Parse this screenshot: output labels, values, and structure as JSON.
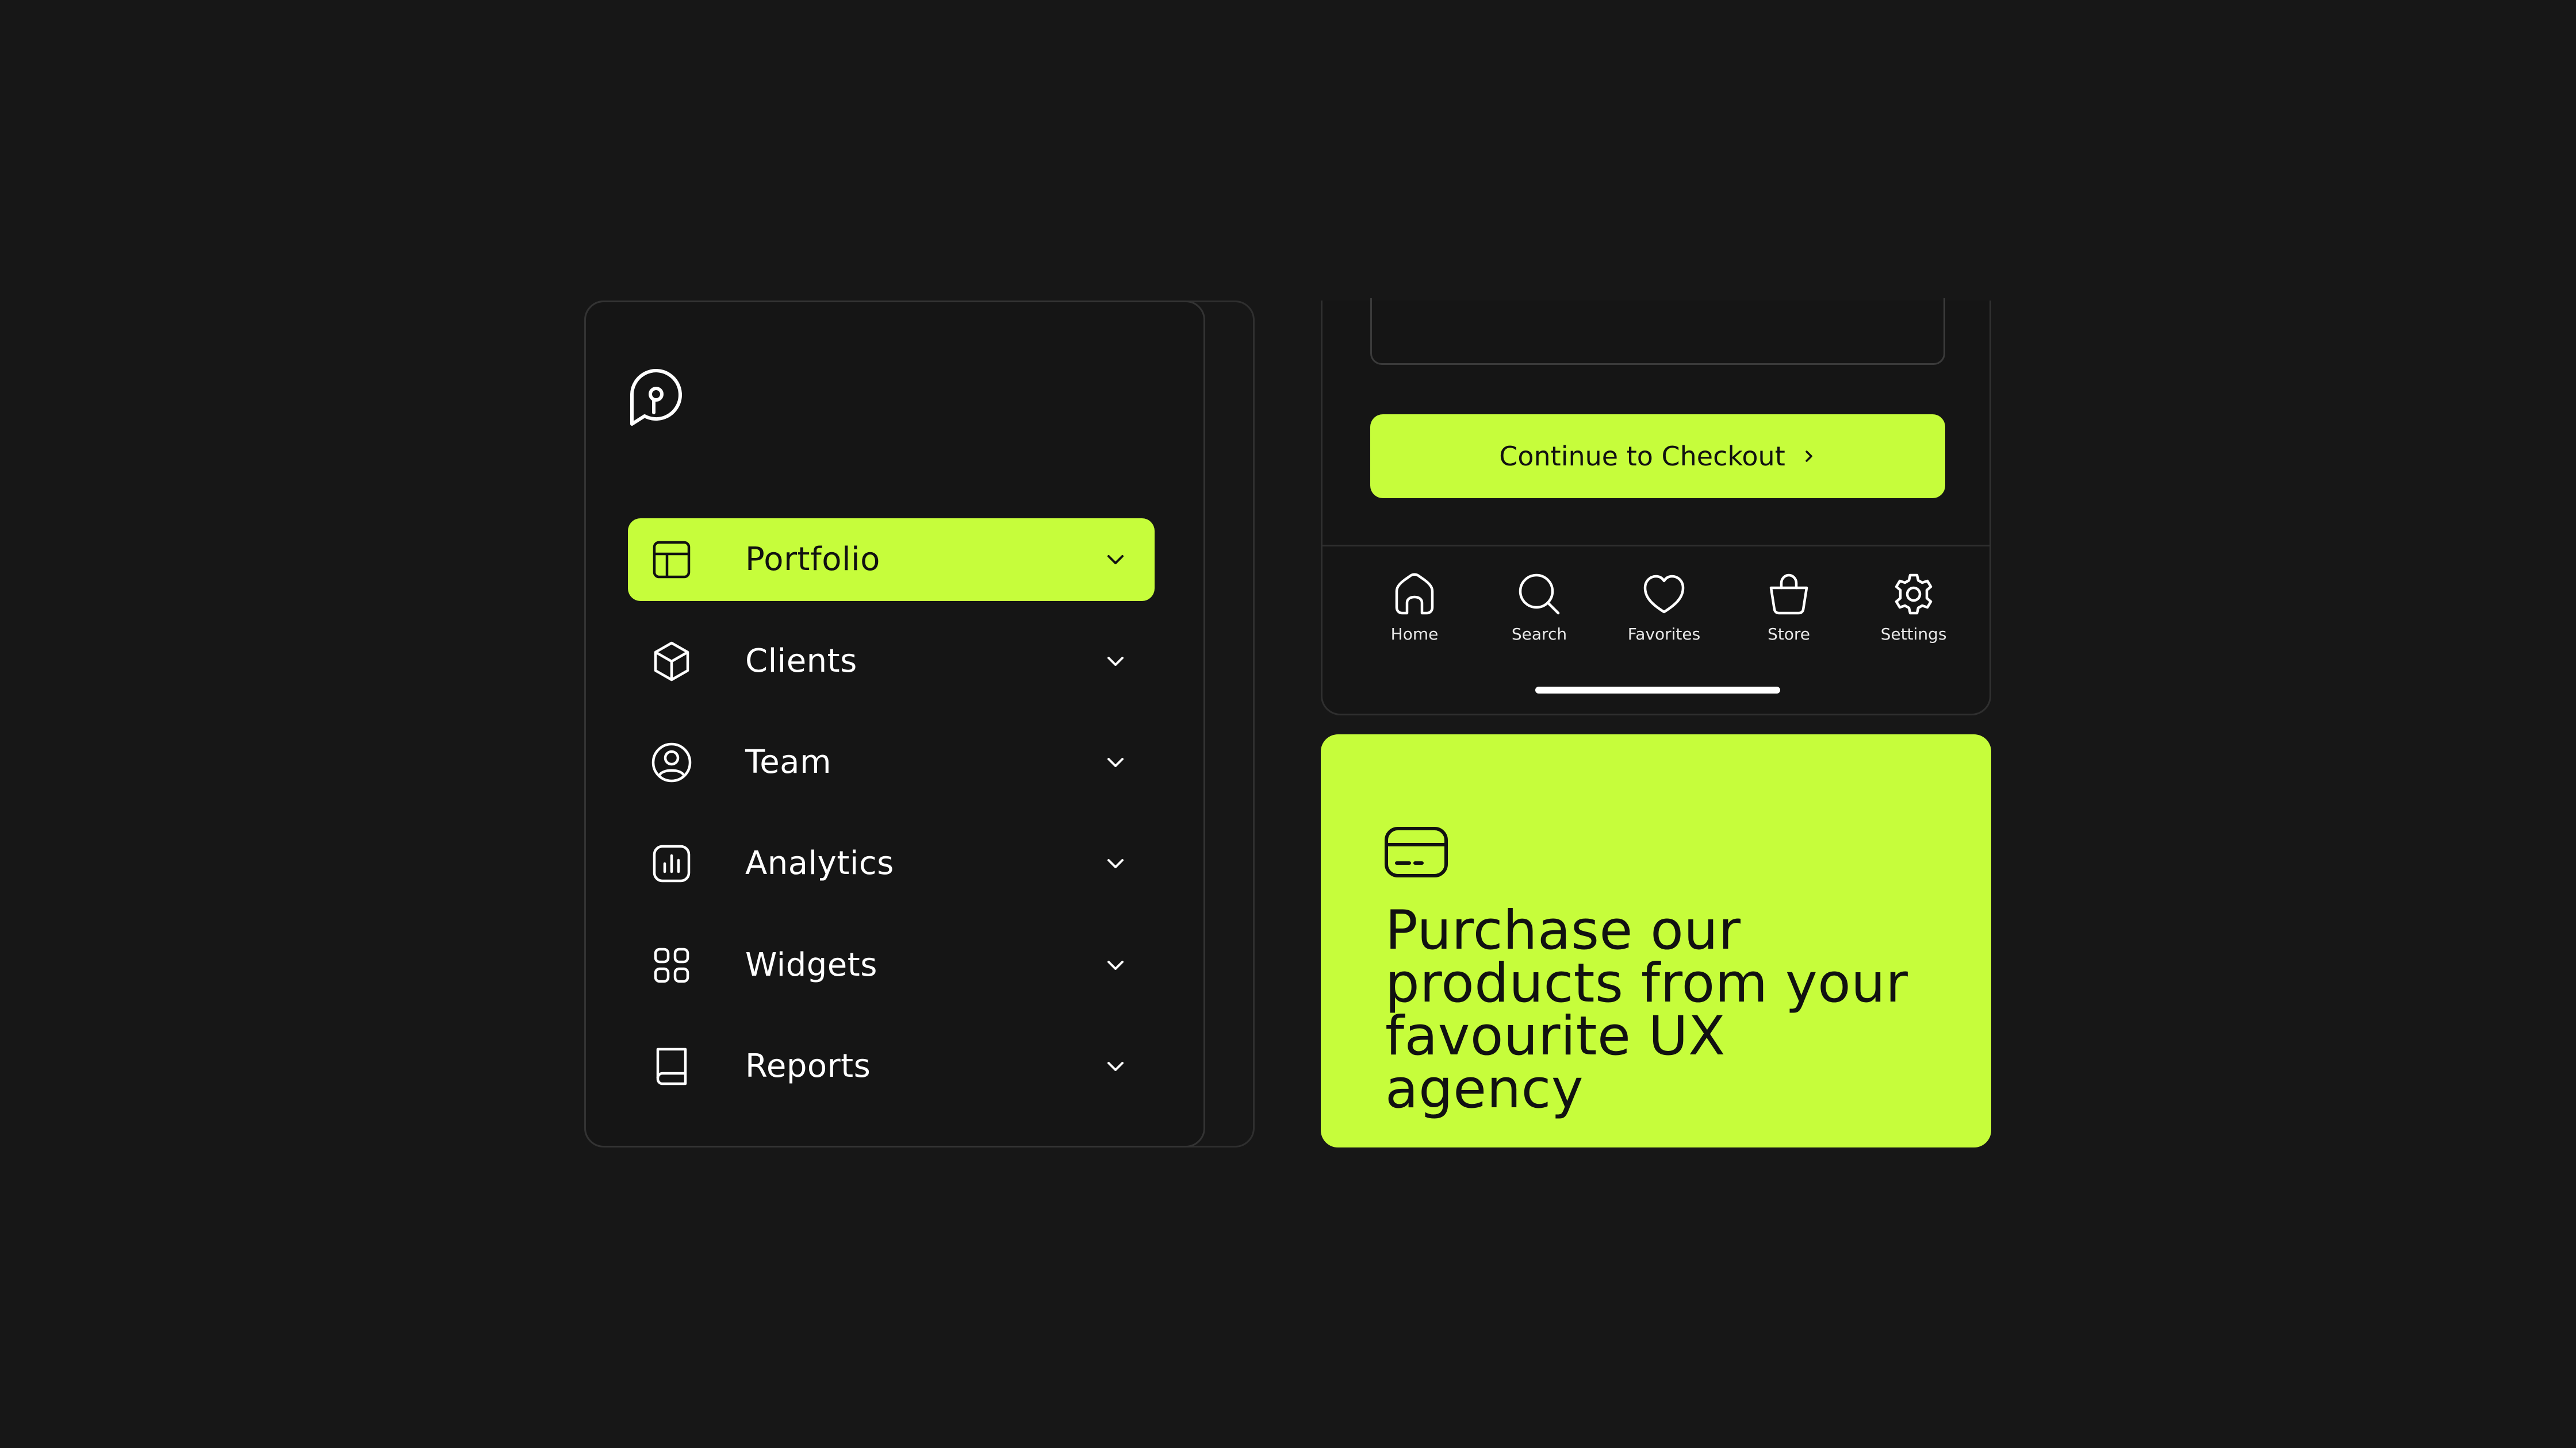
{
  "colors": {
    "background": "#171717",
    "accent": "#c6fd3b",
    "card": "#151515",
    "border": "#333333",
    "text_light": "#ffffff",
    "text_dark": "#111111"
  },
  "sidebar": {
    "logo_icon": "pin-chat-logo-icon",
    "items": [
      {
        "label": "Portfolio",
        "icon": "layout-icon",
        "active": true
      },
      {
        "label": "Clients",
        "icon": "cube-icon",
        "active": false
      },
      {
        "label": "Team",
        "icon": "user-circle-icon",
        "active": false
      },
      {
        "label": "Analytics",
        "icon": "bar-chart-icon",
        "active": false
      },
      {
        "label": "Widgets",
        "icon": "grid-icon",
        "active": false
      },
      {
        "label": "Reports",
        "icon": "book-icon",
        "active": false
      }
    ]
  },
  "checkout": {
    "button_label": "Continue to Checkout"
  },
  "tabbar": {
    "tabs": [
      {
        "label": "Home",
        "icon": "home-icon"
      },
      {
        "label": "Search",
        "icon": "search-icon"
      },
      {
        "label": "Favorites",
        "icon": "heart-icon"
      },
      {
        "label": "Store",
        "icon": "bag-icon"
      },
      {
        "label": "Settings",
        "icon": "gear-icon"
      }
    ]
  },
  "promo": {
    "icon": "credit-card-icon",
    "text": "Purchase our products from your favourite UX agency"
  }
}
